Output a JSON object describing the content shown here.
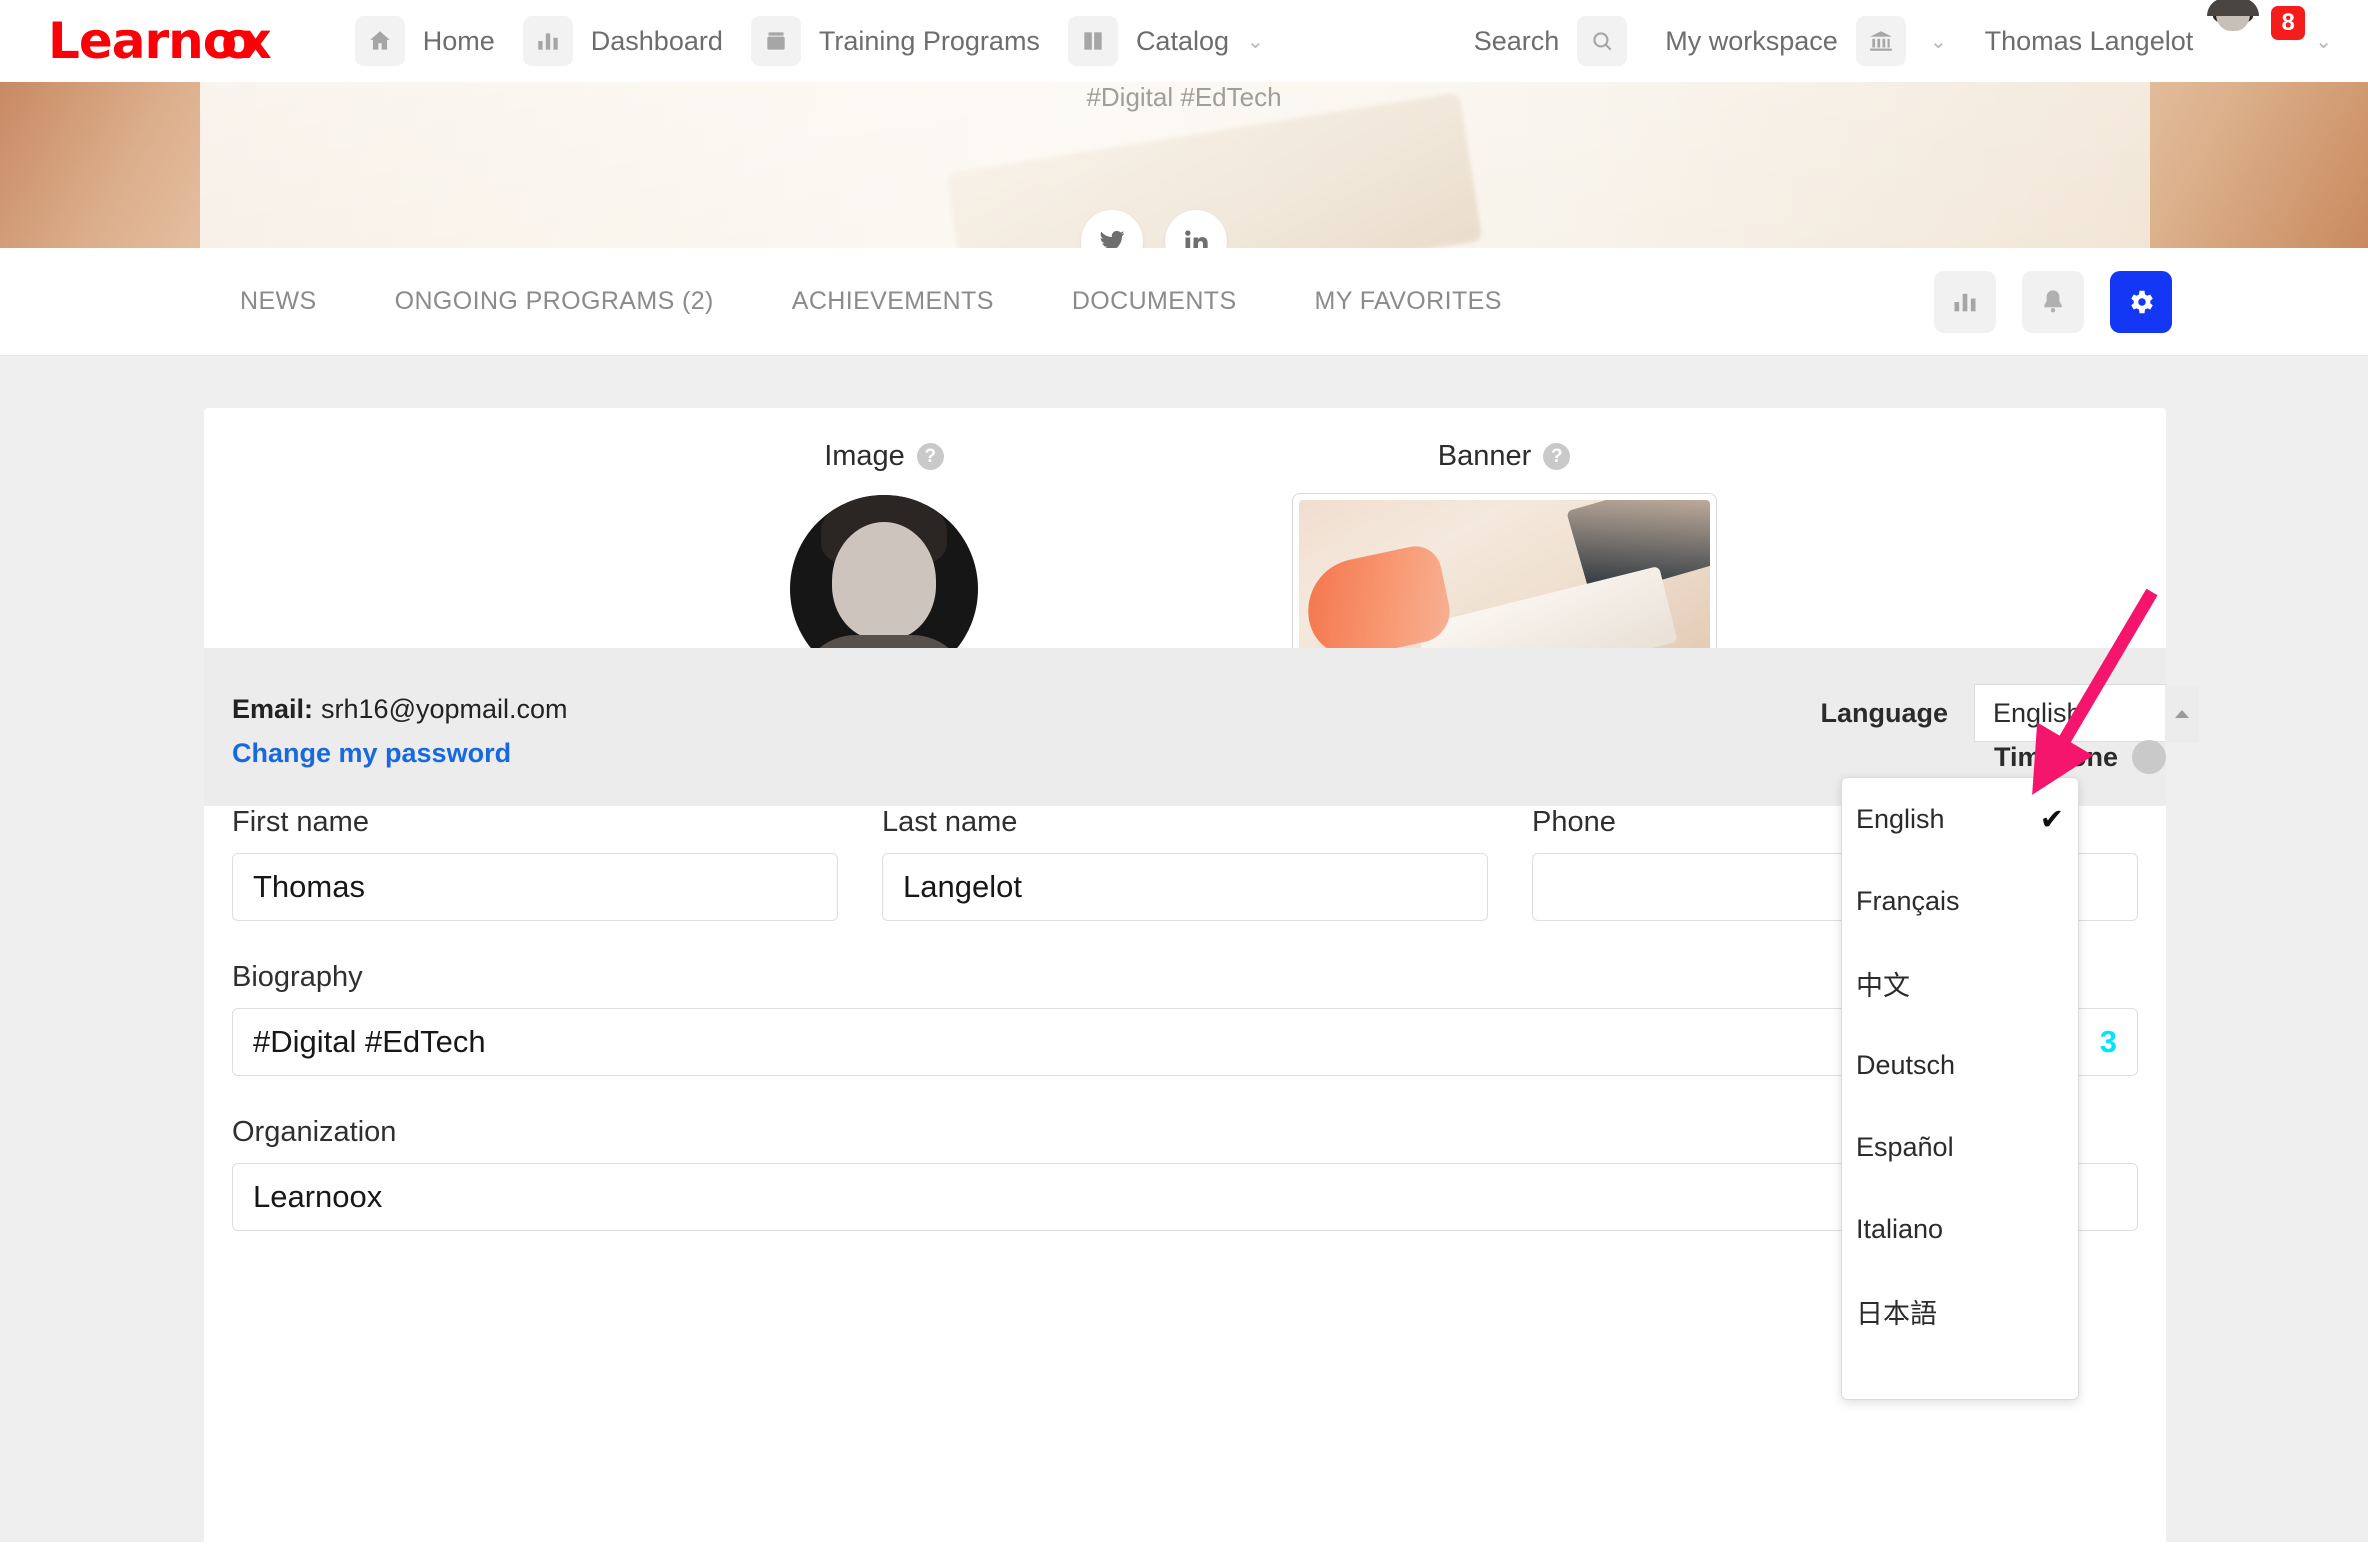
{
  "brand": {
    "name_part1": "Learn",
    "name_oo": "oo",
    "name_part2": "x",
    "color": "#fb0007"
  },
  "topnav": {
    "items": [
      {
        "label": "Home",
        "icon": "home-icon"
      },
      {
        "label": "Dashboard",
        "icon": "bar-chart-icon"
      },
      {
        "label": "Training Programs",
        "icon": "folder-icon"
      },
      {
        "label": "Catalog",
        "icon": "book-icon",
        "caret": "⌄"
      }
    ],
    "search_label": "Search",
    "workspace_label": "My workspace",
    "workspace_caret": "⌄",
    "user_name": "Thomas Langelot",
    "user_caret": "⌄",
    "notification_count": "8"
  },
  "hero": {
    "tagline": "#Digital #EdTech",
    "socials": [
      {
        "name": "twitter-icon"
      },
      {
        "name": "linkedin-icon"
      }
    ]
  },
  "tabs": [
    {
      "label": "NEWS"
    },
    {
      "label": "ONGOING PROGRAMS (2)"
    },
    {
      "label": "ACHIEVEMENTS"
    },
    {
      "label": "DOCUMENTS"
    },
    {
      "label": "MY FAVORITES"
    }
  ],
  "tab_actions": [
    {
      "name": "statistics-button",
      "icon": "bar-chart-icon",
      "active": false
    },
    {
      "name": "notifications-button",
      "icon": "bell-icon",
      "active": false
    },
    {
      "name": "settings-button",
      "icon": "gear-icon",
      "active": true,
      "color": "#1436f5"
    }
  ],
  "media": {
    "image_label": "Image",
    "banner_label": "Banner",
    "help_glyph": "?"
  },
  "account": {
    "email_label": "Email:",
    "email_value": "srh16@yopmail.com",
    "change_password_label": "Change my password",
    "language_label": "Language",
    "language_value": "English",
    "timezone_label": "Timezone"
  },
  "language_dropdown": {
    "options": [
      {
        "label": "English",
        "selected": true,
        "check": "✔"
      },
      {
        "label": "Français",
        "selected": false,
        "check": ""
      },
      {
        "label": "中文",
        "selected": false,
        "check": ""
      },
      {
        "label": "Deutsch",
        "selected": false,
        "check": ""
      },
      {
        "label": "Español",
        "selected": false,
        "check": ""
      },
      {
        "label": "Italiano",
        "selected": false,
        "check": ""
      },
      {
        "label": "日本語",
        "selected": false,
        "check": ""
      }
    ]
  },
  "form": {
    "first_name": {
      "label": "First name",
      "value": "Thomas"
    },
    "last_name": {
      "label": "Last name",
      "value": "Langelot"
    },
    "phone": {
      "label": "Phone",
      "value": ""
    },
    "biography": {
      "label": "Biography",
      "value": "#Digital #EdTech"
    },
    "hidden_field_value": "3",
    "organization": {
      "label": "Organization",
      "value": "Learnoox"
    }
  },
  "annotation": {
    "arrow_color": "#f5156c"
  }
}
